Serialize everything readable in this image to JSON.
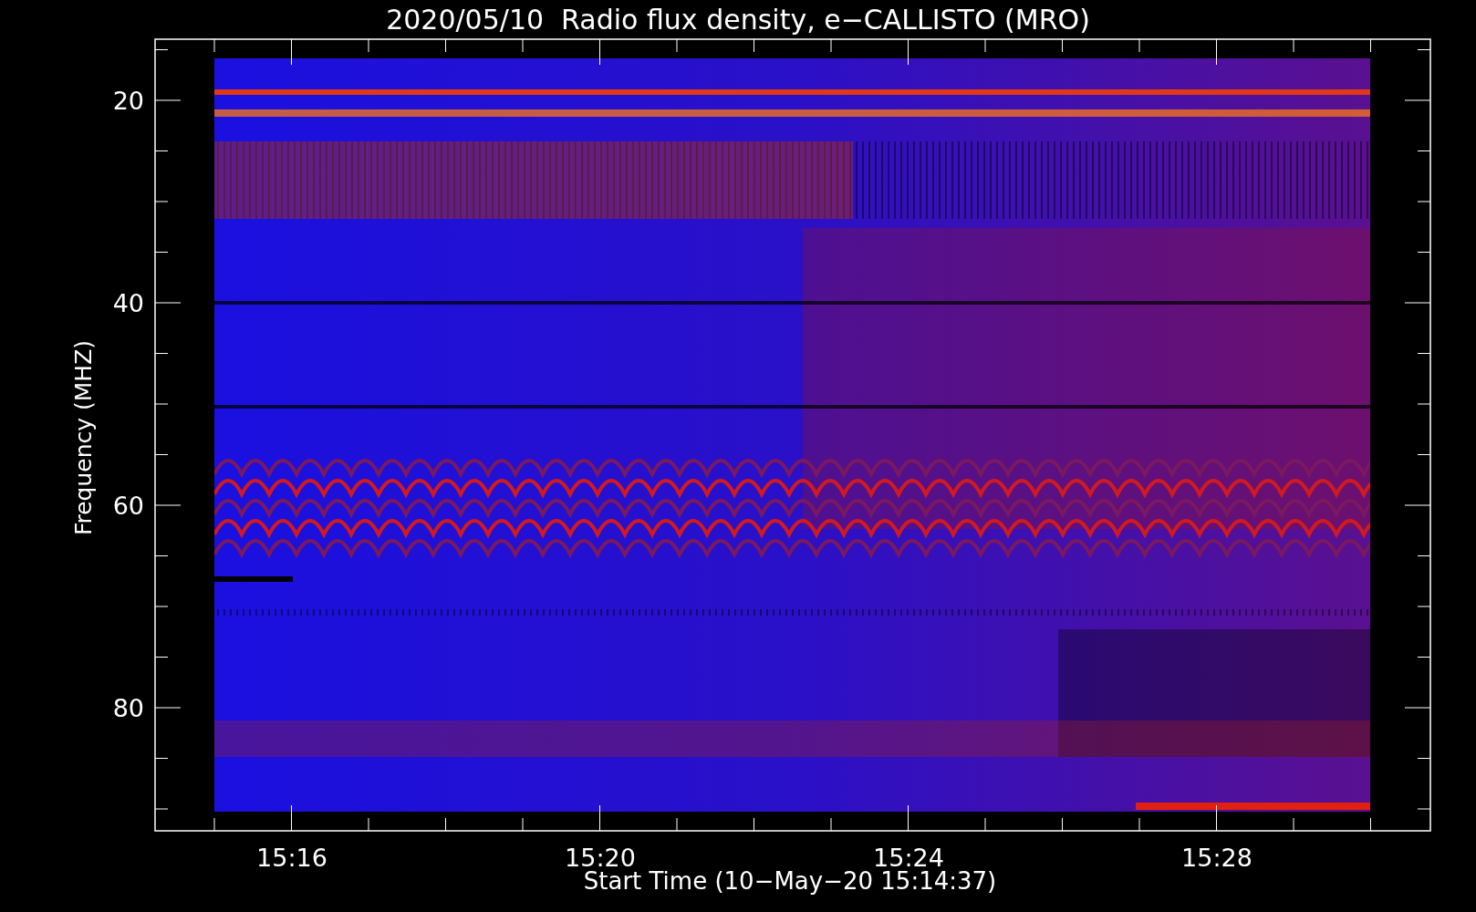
{
  "title": "2020/05/10  Radio flux density, e−CALLISTO (MRO)",
  "y_axis": {
    "label": "Frequency (MHZ)",
    "ticks": [
      "20",
      "40",
      "60",
      "80"
    ]
  },
  "x_axis": {
    "label": "Start Time (10−May−20 15:14:37)",
    "ticks": [
      "15:16",
      "15:20",
      "15:24",
      "15:28"
    ]
  }
}
